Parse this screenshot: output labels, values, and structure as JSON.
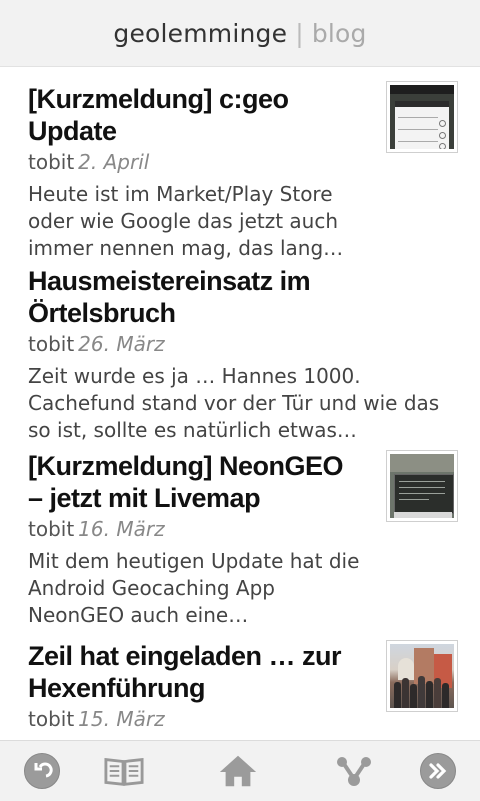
{
  "header": {
    "site": "geolemminge",
    "separator": "|",
    "section": "blog"
  },
  "posts": [
    {
      "title": "[Kurzmeldung] c:geo Update",
      "author": "tobit",
      "date": "2. April",
      "excerpt": "Heute ist im Market/Play Store oder wie Google das jetzt auch immer nennen mag, das lang…",
      "thumb": "app-screenshot"
    },
    {
      "title": "Hausmeistereinsatz im Örtelsbruch",
      "author": "tobit",
      "date": "26. März",
      "excerpt": "Zeit wurde es ja … Hannes 1000. Cachefund stand vor der Tür und wie das so ist, sollte es natürlich etwas…"
    },
    {
      "title": "[Kurzmeldung] NeonGEO – jetzt mit Livemap",
      "author": "tobit",
      "date": "16. März",
      "excerpt": "Mit dem heutigen Update hat die Android Geocaching App NeonGEO auch eine…",
      "thumb": "map-screenshot"
    },
    {
      "title": "Zeil hat eingeladen … zur Hexenführung",
      "author": "tobit",
      "date": "15. März",
      "excerpt": "",
      "thumb": "group-photo"
    }
  ],
  "nav": {
    "items": [
      "back-icon",
      "book-icon",
      "home-icon",
      "share-icon",
      "forward-icon"
    ]
  }
}
